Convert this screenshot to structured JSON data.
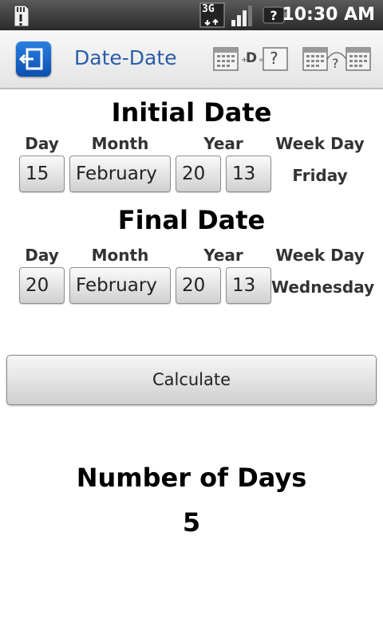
{
  "status_bar": {
    "network_type": "3G",
    "time": "10:30 AM",
    "icons": [
      "sd-card-alert-icon",
      "3g-data-icon",
      "signal-strength-icon",
      "battery-unknown-icon"
    ]
  },
  "action_bar": {
    "app_title": "Date-Date",
    "app_icon": "exit-door-icon",
    "mode_icons": [
      "add-days-mode-icon",
      "days-between-mode-icon"
    ],
    "mode1_text": "D",
    "mode_question": "?"
  },
  "initial_date": {
    "title": "Initial Date",
    "labels": {
      "day": "Day",
      "month": "Month",
      "year": "Year",
      "week_day": "Week Day"
    },
    "day": "15",
    "month": "February",
    "year_century": "20",
    "year_decade": "13",
    "week_day": "Friday"
  },
  "final_date": {
    "title": "Final Date",
    "labels": {
      "day": "Day",
      "month": "Month",
      "year": "Year",
      "week_day": "Week Day"
    },
    "day": "20",
    "month": "February",
    "year_century": "20",
    "year_decade": "13",
    "week_day": "Wednesday"
  },
  "calculate_label": "Calculate",
  "result": {
    "label": "Number of Days",
    "value": "5"
  },
  "colors": {
    "status_bar_bg": "#2a2a2a",
    "action_bar_bg": "#ececec",
    "title_accent": "#2a5da8",
    "app_icon_bg": "#1565c8"
  }
}
